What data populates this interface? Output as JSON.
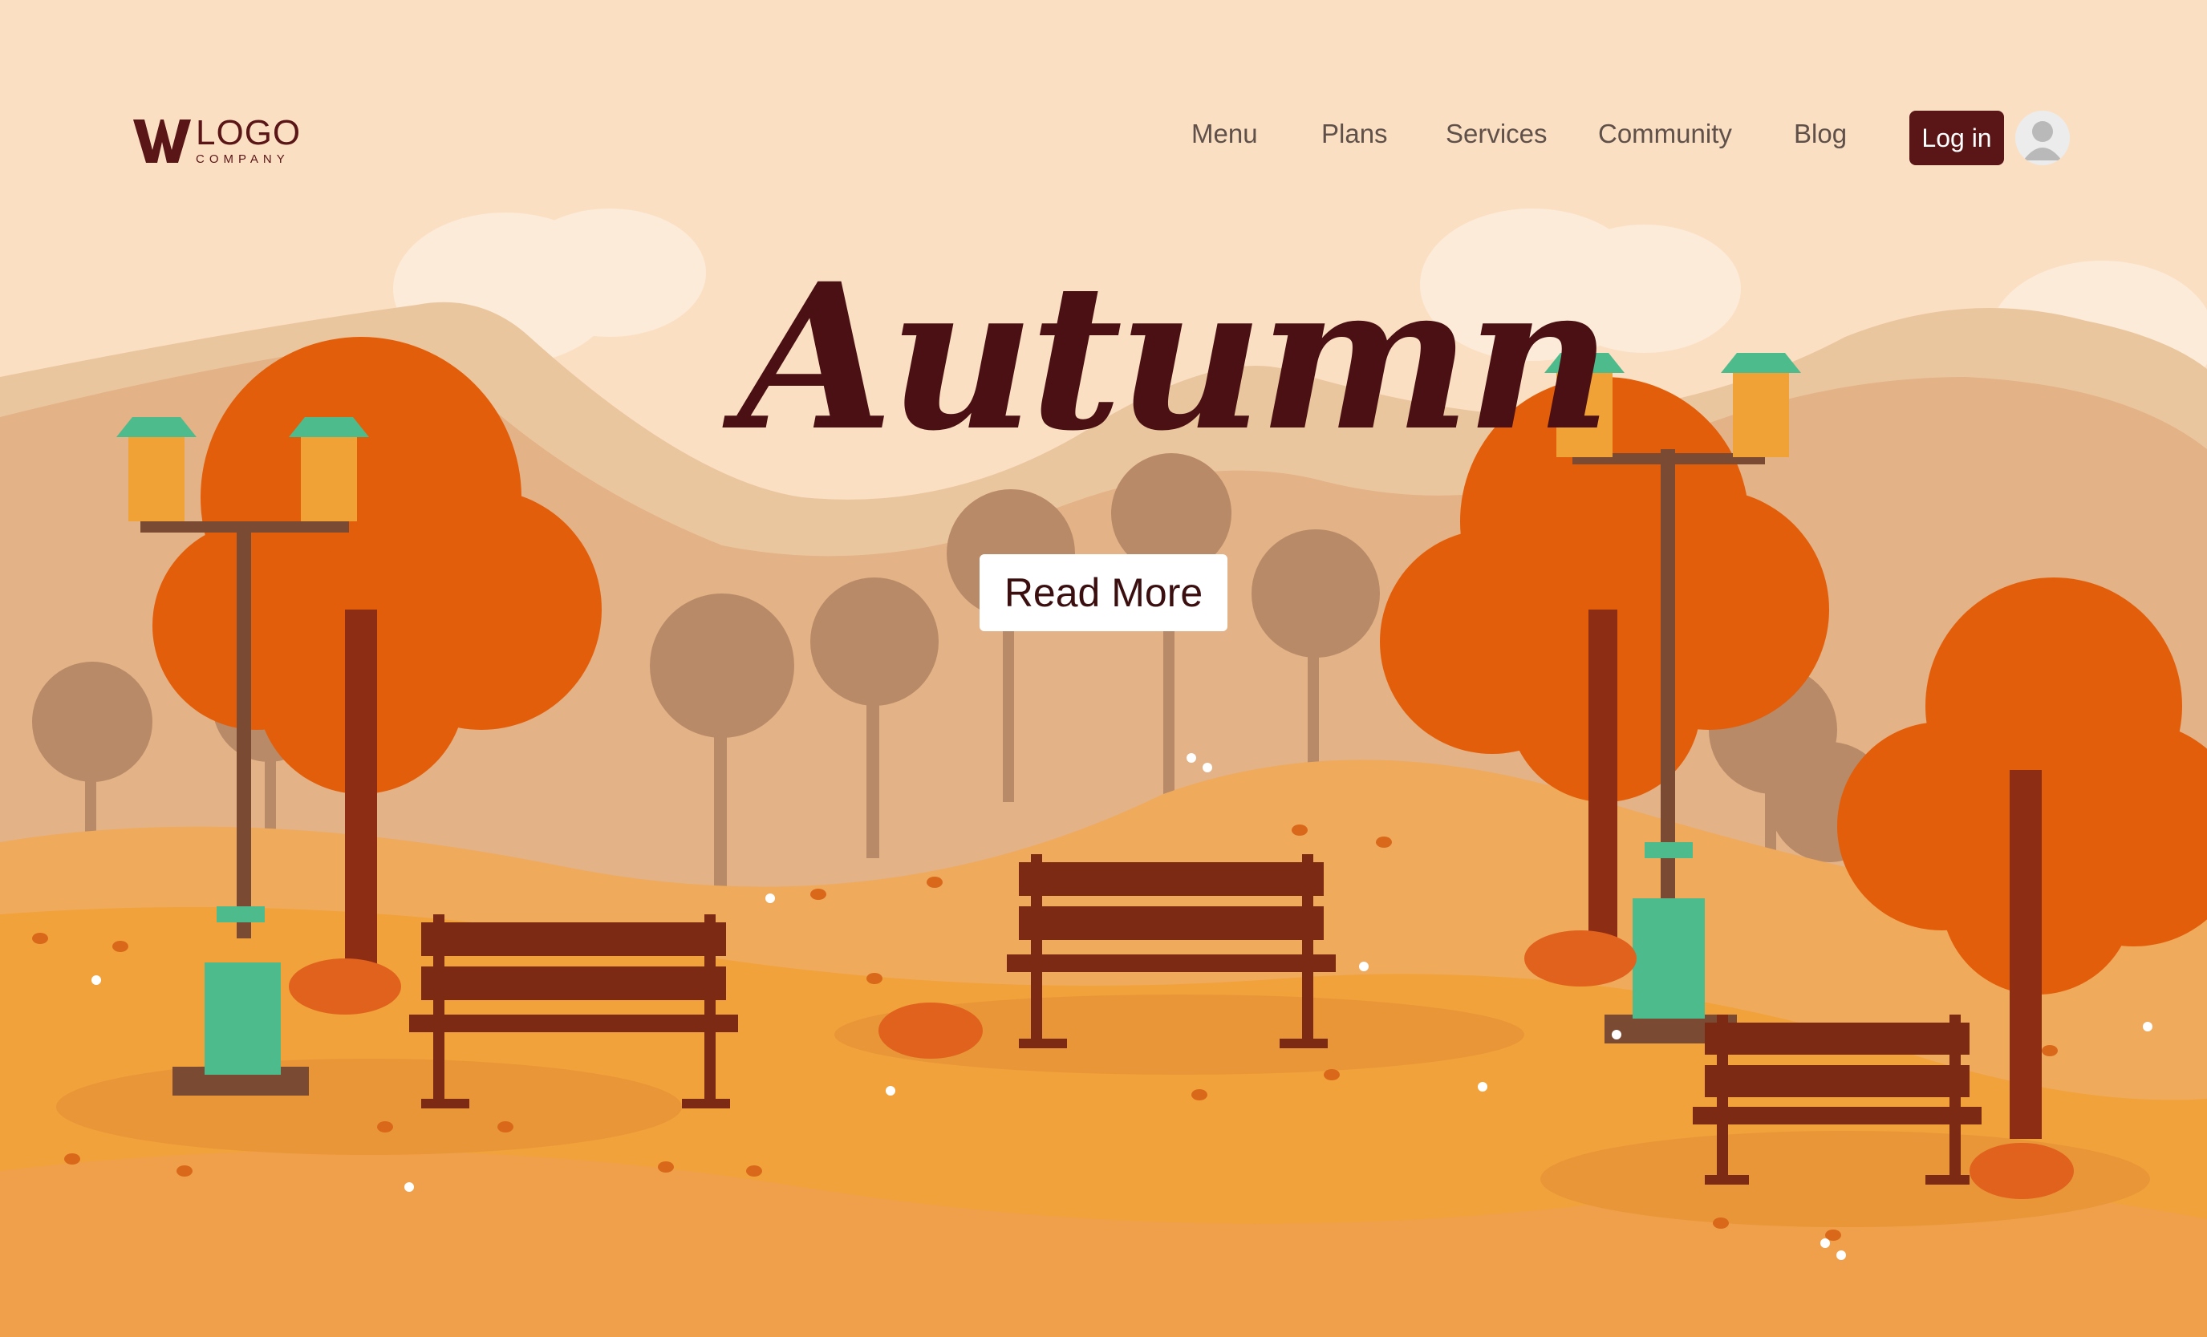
{
  "logo": {
    "word": "LOGO",
    "subtitle": "COMPANY"
  },
  "nav": {
    "items": [
      {
        "label": "Menu"
      },
      {
        "label": "Plans"
      },
      {
        "label": "Services"
      },
      {
        "label": "Community"
      },
      {
        "label": "Blog"
      }
    ],
    "login_label": "Log in"
  },
  "hero": {
    "title": "Autumn",
    "cta_label": "Read More"
  },
  "colors": {
    "brand": "#5a1516",
    "sky": "#fbdfc3",
    "mountain": "#e8bc8e",
    "ground": "#f1a23b",
    "tree_orange": "#e35e0a",
    "bench": "#7c2a14",
    "lamp_accent": "#4dbb8c"
  }
}
